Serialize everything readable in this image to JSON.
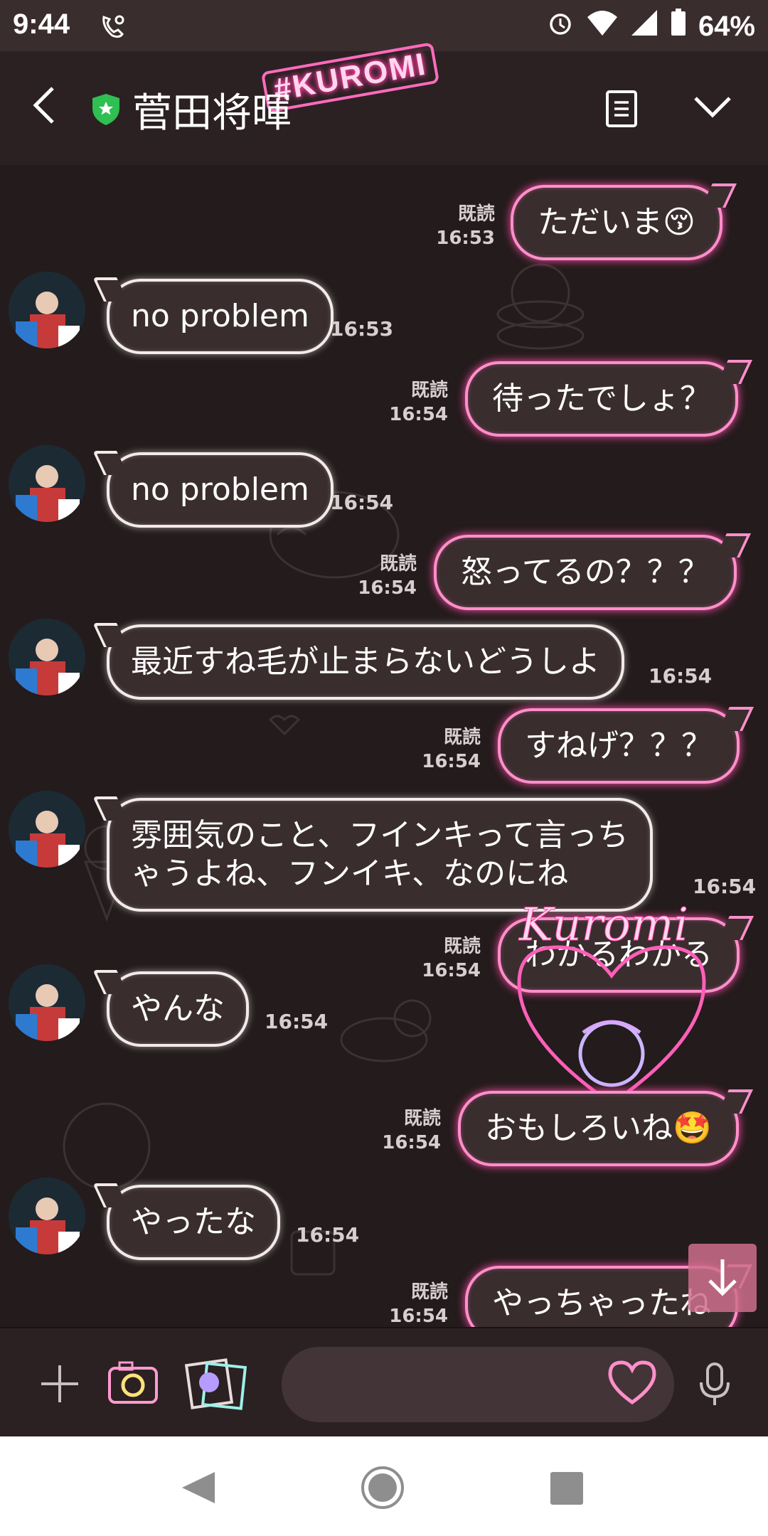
{
  "status_bar": {
    "time": "9:44",
    "battery": "64%"
  },
  "header": {
    "contact_name": "菅田将暉",
    "theme_tag": "#KUROMI"
  },
  "messages": [
    {
      "side": "out",
      "text": "ただいま😚",
      "read": "既読",
      "time": "16:53"
    },
    {
      "side": "in",
      "text": "no problem",
      "time": "16:53"
    },
    {
      "side": "out",
      "text": "待ったでしょ？",
      "read": "既読",
      "time": "16:54"
    },
    {
      "side": "in",
      "text": "no problem",
      "time": "16:54"
    },
    {
      "side": "out",
      "text": "怒ってるの？？？",
      "read": "既読",
      "time": "16:54"
    },
    {
      "side": "in",
      "text": "最近すね毛が止まらないどうしよ",
      "time": "16:54"
    },
    {
      "side": "out",
      "text": "すねげ？？？",
      "read": "既読",
      "time": "16:54"
    },
    {
      "side": "in",
      "text_line1": "雰囲気のこと、フインキって言っち",
      "text_line2": "ゃうよね、フンイキ、なのにね",
      "time": "16:54"
    },
    {
      "side": "out",
      "text": "わかるわかる",
      "read": "既読",
      "time": "16:54"
    },
    {
      "side": "in",
      "text": "やんな",
      "time": "16:54"
    },
    {
      "side": "out",
      "text": "おもしろいね🤩",
      "read": "既読",
      "time": "16:54"
    },
    {
      "side": "in",
      "text": "やったな",
      "time": "16:54"
    },
    {
      "side": "out",
      "text": "やっちゃったね",
      "read": "既読",
      "time": "16:54"
    }
  ],
  "sticker": {
    "text": "Kuromi"
  },
  "input": {
    "placeholder": ""
  },
  "colors": {
    "outgoing_border": "#ff8fca",
    "incoming_border": "#f3eaea",
    "background": "#241b1c"
  },
  "icons": [
    "back-icon",
    "shield-icon",
    "notes-icon",
    "chevron-down-icon",
    "plus-icon",
    "camera-icon",
    "gallery-icon",
    "heart-icon",
    "mic-icon",
    "scroll-down-icon"
  ]
}
